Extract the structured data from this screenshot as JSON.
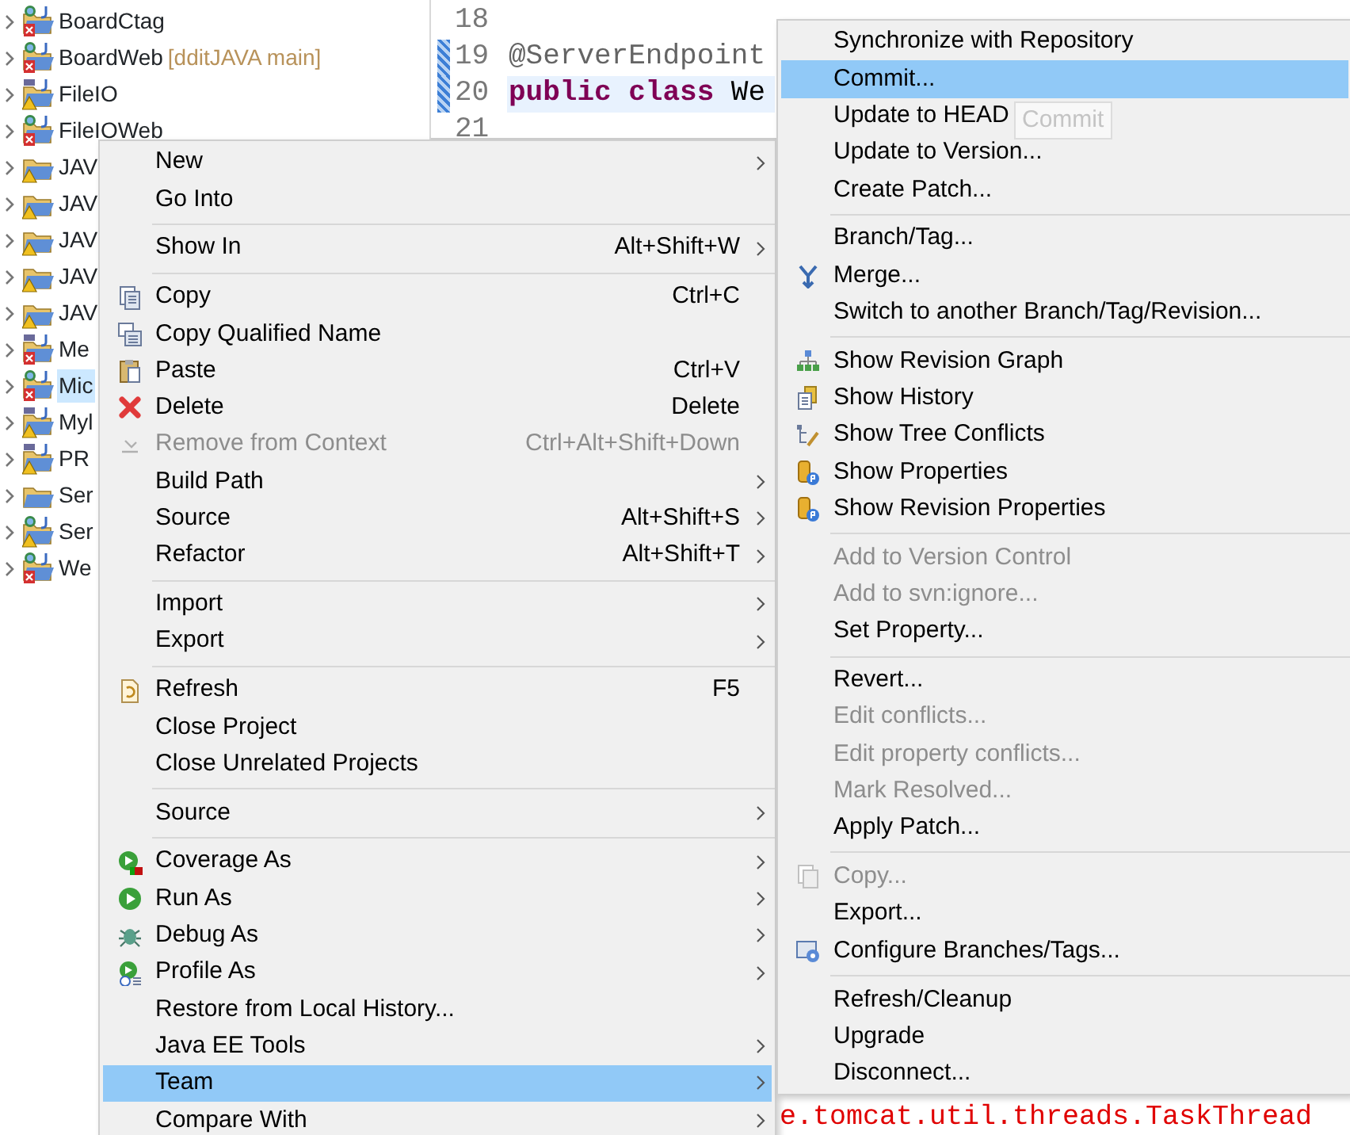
{
  "project_tree": [
    {
      "label": "BoardCtag",
      "kind": "web",
      "expanded": false,
      "selected": false
    },
    {
      "label": "BoardWeb",
      "repo": "[dditJAVA main]",
      "kind": "web",
      "expanded": false,
      "selected": false
    },
    {
      "label": "FileIO",
      "kind": "java",
      "expanded": false,
      "selected": false
    },
    {
      "label": "FileIOWeb",
      "kind": "web",
      "expanded": false,
      "selected": false
    },
    {
      "label": "JAV",
      "kind": "folder",
      "expanded": false,
      "selected": false
    },
    {
      "label": "JAV",
      "kind": "folder",
      "expanded": false,
      "selected": false
    },
    {
      "label": "JAV",
      "kind": "folder",
      "expanded": false,
      "selected": false
    },
    {
      "label": "JAV",
      "kind": "folder",
      "expanded": false,
      "selected": false
    },
    {
      "label": "JAV",
      "kind": "folder",
      "expanded": false,
      "selected": false
    },
    {
      "label": "Me",
      "kind": "java",
      "expanded": false,
      "selected": false
    },
    {
      "label": "Mic",
      "kind": "web",
      "expanded": false,
      "selected": true
    },
    {
      "label": "Myl",
      "kind": "java",
      "expanded": false,
      "selected": false
    },
    {
      "label": "PR",
      "kind": "java",
      "expanded": false,
      "selected": false
    },
    {
      "label": "Ser",
      "kind": "folder",
      "expanded": false,
      "selected": false
    },
    {
      "label": "Ser",
      "kind": "web",
      "expanded": false,
      "selected": false
    },
    {
      "label": "We",
      "kind": "web",
      "expanded": false,
      "selected": false
    }
  ],
  "editor": {
    "lines": [
      {
        "number": "18",
        "changed": false,
        "current": false
      },
      {
        "number": "19",
        "changed": true,
        "current": false,
        "tokens": [
          {
            "text": "@ServerEndpoint",
            "kind": "annotation"
          }
        ]
      },
      {
        "number": "20",
        "changed": true,
        "current": true,
        "tokens": [
          {
            "text": "public",
            "kind": "keyword"
          },
          {
            "text": " class",
            "kind": "keyword"
          },
          {
            "text": " We",
            "kind": "plain"
          }
        ]
      },
      {
        "number": "21",
        "changed": false,
        "current": false
      }
    ]
  },
  "console": {
    "text": "e.tomcat.util.threads.TaskThread"
  },
  "context_menu": {
    "items": [
      {
        "kind": "item",
        "label": "New",
        "submenu": true,
        "disabled": false,
        "selected": false
      },
      {
        "kind": "item",
        "label": "Go Into",
        "submenu": false,
        "disabled": false,
        "selected": false
      },
      {
        "kind": "separator"
      },
      {
        "kind": "item",
        "label": "Show In",
        "shortcut": "Alt+Shift+W",
        "submenu": true,
        "disabled": false,
        "selected": false
      },
      {
        "kind": "separator"
      },
      {
        "kind": "item",
        "label": "Copy",
        "shortcut": "Ctrl+C",
        "submenu": false,
        "disabled": false,
        "selected": false
      },
      {
        "kind": "item",
        "label": "Copy Qualified Name",
        "submenu": false,
        "disabled": false,
        "selected": false
      },
      {
        "kind": "item",
        "label": "Paste",
        "shortcut": "Ctrl+V",
        "submenu": false,
        "disabled": false,
        "selected": false
      },
      {
        "kind": "item",
        "label": "Delete",
        "shortcut": "Delete",
        "submenu": false,
        "disabled": false,
        "selected": false
      },
      {
        "kind": "item",
        "label": "Remove from Context",
        "shortcut": "Ctrl+Alt+Shift+Down",
        "submenu": false,
        "disabled": true,
        "selected": false
      },
      {
        "kind": "item",
        "label": "Build Path",
        "submenu": true,
        "disabled": false,
        "selected": false
      },
      {
        "kind": "item",
        "label": "Source",
        "shortcut": "Alt+Shift+S",
        "submenu": true,
        "disabled": false,
        "selected": false
      },
      {
        "kind": "item",
        "label": "Refactor",
        "shortcut": "Alt+Shift+T",
        "submenu": true,
        "disabled": false,
        "selected": false
      },
      {
        "kind": "separator"
      },
      {
        "kind": "item",
        "label": "Import",
        "submenu": true,
        "disabled": false,
        "selected": false
      },
      {
        "kind": "item",
        "label": "Export",
        "submenu": true,
        "disabled": false,
        "selected": false
      },
      {
        "kind": "separator"
      },
      {
        "kind": "item",
        "label": "Refresh",
        "shortcut": "F5",
        "submenu": false,
        "disabled": false,
        "selected": false
      },
      {
        "kind": "item",
        "label": "Close Project",
        "submenu": false,
        "disabled": false,
        "selected": false
      },
      {
        "kind": "item",
        "label": "Close Unrelated Projects",
        "submenu": false,
        "disabled": false,
        "selected": false
      },
      {
        "kind": "separator"
      },
      {
        "kind": "item",
        "label": "Source",
        "submenu": true,
        "disabled": false,
        "selected": false
      },
      {
        "kind": "separator"
      },
      {
        "kind": "item",
        "label": "Coverage As",
        "submenu": true,
        "disabled": false,
        "selected": false
      },
      {
        "kind": "item",
        "label": "Run As",
        "submenu": true,
        "disabled": false,
        "selected": false
      },
      {
        "kind": "item",
        "label": "Debug As",
        "submenu": true,
        "disabled": false,
        "selected": false
      },
      {
        "kind": "item",
        "label": "Profile As",
        "submenu": true,
        "disabled": false,
        "selected": false
      },
      {
        "kind": "item",
        "label": "Restore from Local History...",
        "submenu": false,
        "disabled": false,
        "selected": false
      },
      {
        "kind": "item",
        "label": "Java EE Tools",
        "submenu": true,
        "disabled": false,
        "selected": false
      },
      {
        "kind": "item",
        "label": "Team",
        "submenu": true,
        "disabled": false,
        "selected": true
      },
      {
        "kind": "item",
        "label": "Compare With",
        "submenu": true,
        "disabled": false,
        "selected": false
      }
    ]
  },
  "team_submenu": {
    "items": [
      {
        "kind": "item",
        "label": "Synchronize with Repository",
        "disabled": false,
        "selected": false
      },
      {
        "kind": "item",
        "label": "Commit...",
        "disabled": false,
        "selected": true
      },
      {
        "kind": "item",
        "label": "Update to HEAD",
        "disabled": false,
        "selected": false
      },
      {
        "kind": "item",
        "label": "Update to Version...",
        "disabled": false,
        "selected": false
      },
      {
        "kind": "item",
        "label": "Create Patch...",
        "disabled": false,
        "selected": false
      },
      {
        "kind": "separator"
      },
      {
        "kind": "item",
        "label": "Branch/Tag...",
        "disabled": false,
        "selected": false
      },
      {
        "kind": "item",
        "label": "Merge...",
        "disabled": false,
        "selected": false
      },
      {
        "kind": "item",
        "label": "Switch to another Branch/Tag/Revision...",
        "disabled": false,
        "selected": false
      },
      {
        "kind": "separator"
      },
      {
        "kind": "item",
        "label": "Show Revision Graph",
        "disabled": false,
        "selected": false
      },
      {
        "kind": "item",
        "label": "Show History",
        "disabled": false,
        "selected": false
      },
      {
        "kind": "item",
        "label": "Show Tree Conflicts",
        "disabled": false,
        "selected": false
      },
      {
        "kind": "item",
        "label": "Show Properties",
        "disabled": false,
        "selected": false
      },
      {
        "kind": "item",
        "label": "Show Revision Properties",
        "disabled": false,
        "selected": false
      },
      {
        "kind": "separator"
      },
      {
        "kind": "item",
        "label": "Add to Version Control",
        "disabled": true,
        "selected": false
      },
      {
        "kind": "item",
        "label": "Add to svn:ignore...",
        "disabled": true,
        "selected": false
      },
      {
        "kind": "item",
        "label": "Set Property...",
        "disabled": false,
        "selected": false
      },
      {
        "kind": "separator"
      },
      {
        "kind": "item",
        "label": "Revert...",
        "disabled": false,
        "selected": false
      },
      {
        "kind": "item",
        "label": "Edit conflicts...",
        "disabled": true,
        "selected": false
      },
      {
        "kind": "item",
        "label": "Edit property conflicts...",
        "disabled": true,
        "selected": false
      },
      {
        "kind": "item",
        "label": "Mark Resolved...",
        "disabled": true,
        "selected": false
      },
      {
        "kind": "item",
        "label": "Apply Patch...",
        "disabled": false,
        "selected": false
      },
      {
        "kind": "separator"
      },
      {
        "kind": "item",
        "label": "Copy...",
        "disabled": true,
        "selected": false
      },
      {
        "kind": "item",
        "label": "Export...",
        "disabled": false,
        "selected": false
      },
      {
        "kind": "item",
        "label": "Configure Branches/Tags...",
        "disabled": false,
        "selected": false
      },
      {
        "kind": "separator"
      },
      {
        "kind": "item",
        "label": "Refresh/Cleanup",
        "disabled": false,
        "selected": false
      },
      {
        "kind": "item",
        "label": "Upgrade",
        "disabled": false,
        "selected": false
      },
      {
        "kind": "item",
        "label": "Disconnect...",
        "disabled": false,
        "selected": false
      }
    ]
  },
  "tooltip": {
    "text": "Commit"
  }
}
